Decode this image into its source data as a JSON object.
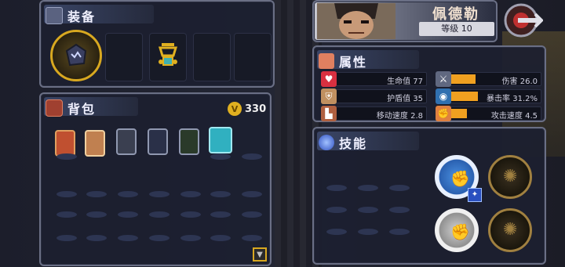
{
  "equipment": {
    "title": "装备"
  },
  "character": {
    "name": "佩德勒",
    "level_label": "等级 10"
  },
  "attributes": {
    "title": "属性",
    "left": [
      {
        "label": "生命值 77",
        "icon": "heart-icon",
        "color": "#d83040"
      },
      {
        "label": "护盾值 35",
        "icon": "shield-icon",
        "color": "#c09060"
      },
      {
        "label": "移动速度 2.8",
        "icon": "boot-icon",
        "color": "#b06040"
      }
    ],
    "right": [
      {
        "label": "伤害 26.0",
        "icon": "sword-icon",
        "color": "#a0a8c0",
        "fill": 0.28
      },
      {
        "label": "暴击率 31.2%",
        "icon": "eye-icon",
        "color": "#60a0e0",
        "fill": 0.31
      },
      {
        "label": "攻击速度 4.5",
        "icon": "fist-icon",
        "color": "#e08040",
        "fill": 0.18
      }
    ]
  },
  "bag": {
    "title": "背包",
    "coins": "330"
  },
  "skills": {
    "title": "技能"
  },
  "colors": {
    "accent": "#f0a020",
    "panel_border": "#6a6f85",
    "gold": "#d8a820"
  }
}
